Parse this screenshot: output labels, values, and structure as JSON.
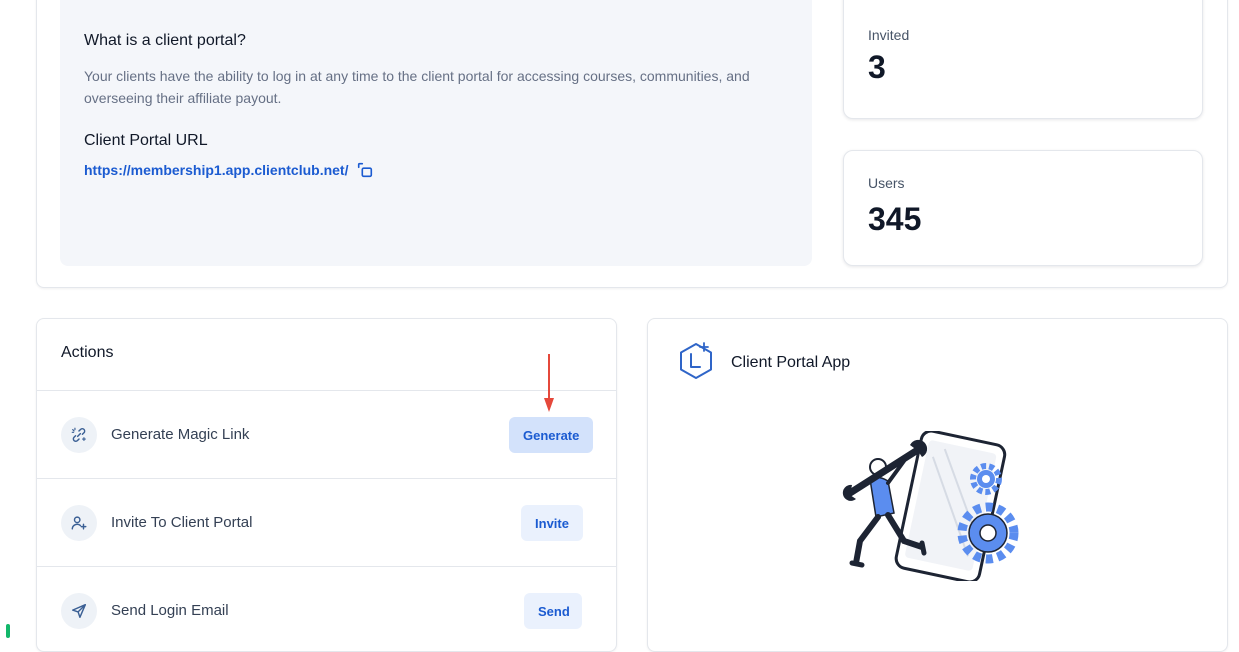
{
  "portal_info": {
    "title": "What is a client portal?",
    "description": "Your clients have the ability to log in at any time to the client portal for accessing courses, communities, and overseeing their affiliate payout.",
    "url_label": "Client Portal URL",
    "url": "https://membership1.app.clientclub.net/",
    "copy_icon": "copy-icon"
  },
  "stats": {
    "invited": {
      "label": "Invited",
      "value": "3"
    },
    "users": {
      "label": "Users",
      "value": "345"
    }
  },
  "actions": {
    "title": "Actions",
    "items": [
      {
        "label": "Generate Magic Link",
        "button": "Generate",
        "icon": "magic-link-icon"
      },
      {
        "label": "Invite To Client Portal",
        "button": "Invite",
        "icon": "user-plus-icon"
      },
      {
        "label": "Send Login Email",
        "button": "Send",
        "icon": "send-icon"
      }
    ]
  },
  "app": {
    "title": "Client Portal App",
    "icon": "hexagon-logo-icon",
    "illustration": "mechanic-phone-gears-illustration"
  },
  "colors": {
    "link": "#1b5bd1",
    "button_bg": "#eaf1fd",
    "button_active_bg": "#d3e2fb",
    "arrow": "#e5483b",
    "panel_bg": "#f4f6fa",
    "illustration_accent": "#5b8def"
  }
}
